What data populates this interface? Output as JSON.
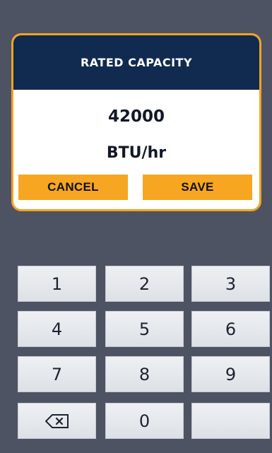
{
  "dialog": {
    "title": "RATED CAPACITY",
    "value": "42000",
    "unit": "BTU/hr",
    "cancel_label": "CANCEL",
    "save_label": "SAVE"
  },
  "keypad": {
    "k1": "1",
    "k2": "2",
    "k3": "3",
    "k4": "4",
    "k5": "5",
    "k6": "6",
    "k7": "7",
    "k8": "8",
    "k9": "9",
    "k0": "0",
    "backspace_icon": "backspace-icon"
  },
  "colors": {
    "background": "#4e5363",
    "dialog_border": "#f3a322",
    "dialog_header": "#112a4f",
    "button": "#f6a621"
  }
}
